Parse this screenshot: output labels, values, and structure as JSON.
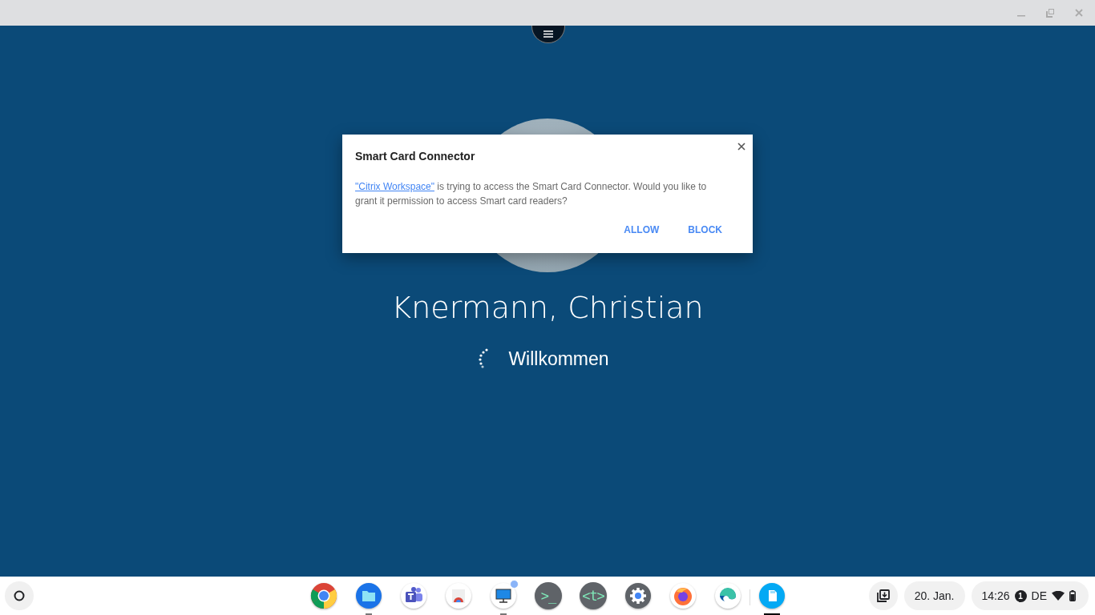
{
  "login": {
    "user_name": "Knermann, Christian",
    "greeting": "Willkommen"
  },
  "dialog": {
    "title": "Smart Card Connector",
    "link": "\"Citrix Workspace\"",
    "message": " is trying to access the Smart Card Connector. Would you like to grant it permission to access Smart card readers?",
    "buttons": [
      "ALLOW",
      "BLOCK"
    ]
  },
  "shelf": {
    "apps": [
      {
        "kind": "chrome",
        "running": false,
        "active": false,
        "notification": false
      },
      {
        "kind": "files",
        "running": true,
        "active": false,
        "notification": false
      },
      {
        "kind": "teams",
        "running": false,
        "active": false,
        "notification": false
      },
      {
        "kind": "webstore",
        "running": false,
        "active": false,
        "notification": false
      },
      {
        "kind": "remote-desktop",
        "running": true,
        "active": false,
        "notification": true
      },
      {
        "kind": "terminal",
        "running": false,
        "active": false,
        "notification": false,
        "glyph": ">_"
      },
      {
        "kind": "text-editor",
        "running": false,
        "active": false,
        "notification": false,
        "glyph": "<t>"
      },
      {
        "kind": "settings",
        "running": false,
        "active": false,
        "notification": false
      },
      {
        "kind": "firefox",
        "running": false,
        "active": false,
        "notification": false
      },
      {
        "kind": "edge",
        "running": false,
        "active": false,
        "notification": false
      },
      {
        "kind": "smart-card",
        "running": true,
        "active": true,
        "notification": false
      }
    ],
    "date": "20. Jan.",
    "time": "14:26",
    "notification_count": "1",
    "keyboard_layout": "DE"
  }
}
